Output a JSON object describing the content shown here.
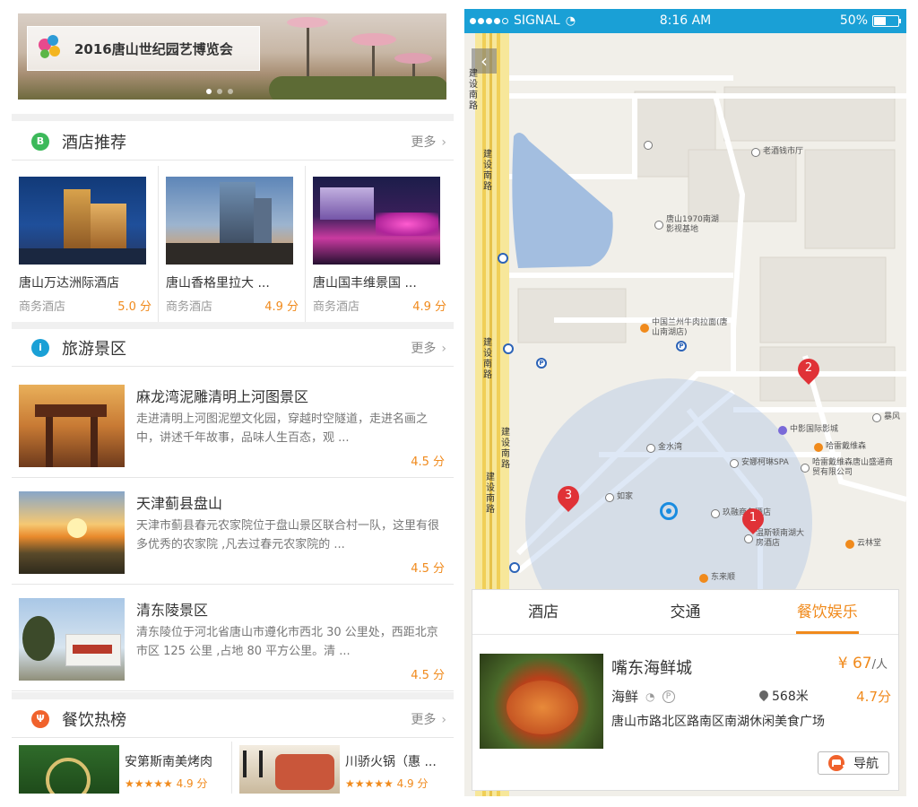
{
  "left": {
    "banner": {
      "title": "2016唐山世纪园艺博览会",
      "dots": 3,
      "active_dot": 1
    },
    "hotel_section": {
      "title": "酒店推荐",
      "more": "更多"
    },
    "hotels": [
      {
        "name": "唐山万达洲际酒店",
        "type": "商务酒店",
        "score": "5.0 分"
      },
      {
        "name": "唐山香格里拉大 ...",
        "type": "商务酒店",
        "score": "4.9 分"
      },
      {
        "name": "唐山国丰维景国 ...",
        "type": "商务酒店",
        "score": "4.9 分"
      }
    ],
    "scenic_section": {
      "title": "旅游景区",
      "more": "更多"
    },
    "spots": [
      {
        "title": "麻龙湾泥雕清明上河图景区",
        "desc": "走进清明上河图泥塑文化园，穿越时空隧道，走进名画之中，讲述千年故事，品味人生百态，观 ...",
        "score": "4.5 分"
      },
      {
        "title": "天津蓟县盘山",
        "desc": "天津市蓟县春元农家院位于盘山景区联合村一队，这里有很多优秀的农家院 ,凡去过春元农家院的 ...",
        "score": "4.5 分"
      },
      {
        "title": "清东陵景区",
        "desc": "清东陵位于河北省唐山市遵化市西北 30 公里处，西距北京市区 125 公里 ,占地 80 平方公里。清 ...",
        "score": "4.5 分"
      }
    ],
    "food_section": {
      "title": "餐饮热榜",
      "more": "更多"
    },
    "foods": [
      {
        "name": "安第斯南美烤肉",
        "stars": "★★★★★ 4.9 分"
      },
      {
        "name": "川骄火锅（惠 ...",
        "stars": "★★★★★ 4.9 分"
      }
    ]
  },
  "right": {
    "status": {
      "carrier": "SIGNAL",
      "time": "8:16 AM",
      "battery": "50%"
    },
    "map": {
      "roads": [
        "建设南路",
        "建设南路",
        "建设南路",
        "建设南路",
        "建设南路"
      ],
      "pois": [
        "老酒钱市厅",
        "唐山1970南湖影视基地",
        "中国兰州牛肉拉面(唐山南湖店)",
        "中影国际影城",
        "哈雷戴维森",
        "哈雷戴维森唐山盛通商贸有限公司",
        "安娜柯琳SPA",
        "金水湾",
        "如家",
        "玖融商务酒店",
        "温斯顿南湖大房酒店",
        "云林堂",
        "东来顺",
        "暴风"
      ],
      "pins": [
        "2",
        "3",
        "1"
      ]
    },
    "tabs": [
      {
        "label": "酒店"
      },
      {
        "label": "交通"
      },
      {
        "label": "餐饮娱乐"
      }
    ],
    "result": {
      "name": "嘴东海鲜城",
      "price": "¥ 67",
      "price_unit": "/人",
      "category": "海鲜",
      "wifi": "wifi-icon",
      "parking": "P",
      "distance": "568米",
      "score": "4.7分",
      "address": "唐山市路北区路南区南湖休闲美食广场",
      "nav_label": "导航"
    },
    "colors": {
      "accent": "#f08a1c",
      "status_bar": "#1aa0d6",
      "pin": "#e03237"
    }
  }
}
